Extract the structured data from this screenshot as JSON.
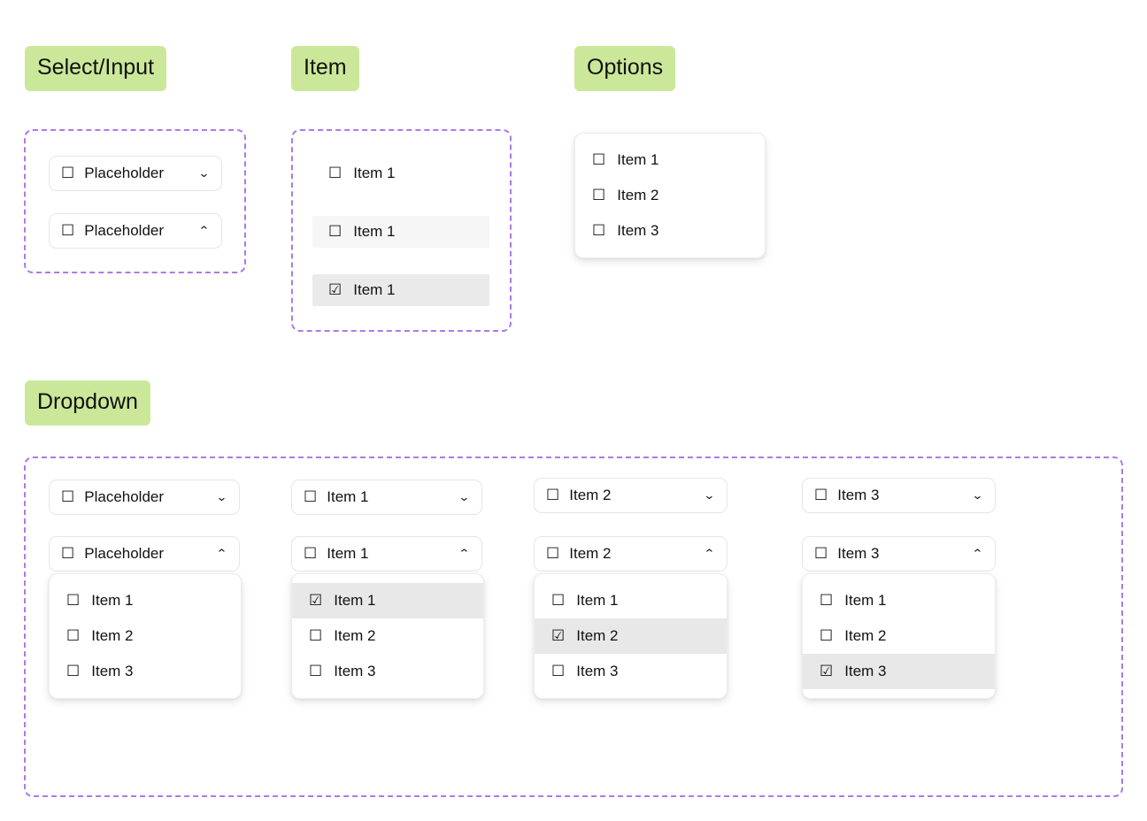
{
  "sections": {
    "select_input": {
      "label": "Select/Input"
    },
    "item": {
      "label": "Item"
    },
    "options": {
      "label": "Options"
    },
    "dropdown": {
      "label": "Dropdown"
    }
  },
  "glyphs": {
    "unchecked": "☐",
    "checked": "☑",
    "chevron_down": "⌄",
    "chevron_up": "⌃"
  },
  "colors": {
    "tag_green": "#cbe89a",
    "dashed_purple": "#ab7ae8",
    "control_border": "#e6e6e6",
    "row_hover": "#f6f6f6",
    "row_selected": "#e8e8e8",
    "text": "#111111"
  },
  "select_input_group": {
    "controls": [
      {
        "text": "Placeholder",
        "state": "closed",
        "checkbox": "unchecked"
      },
      {
        "text": "Placeholder",
        "state": "open",
        "checkbox": "unchecked"
      }
    ]
  },
  "item_group": {
    "rows": [
      {
        "text": "Item 1",
        "checkbox": "unchecked",
        "state": "default"
      },
      {
        "text": "Item 1",
        "checkbox": "unchecked",
        "state": "hover"
      },
      {
        "text": "Item 1",
        "checkbox": "checked",
        "state": "selected"
      }
    ]
  },
  "options_group": {
    "rows": [
      {
        "text": "Item 1",
        "checkbox": "unchecked",
        "state": "default"
      },
      {
        "text": "Item 2",
        "checkbox": "unchecked",
        "state": "default"
      },
      {
        "text": "Item 3",
        "checkbox": "unchecked",
        "state": "default"
      }
    ]
  },
  "dropdown_group": {
    "columns": [
      {
        "closed": {
          "text": "Placeholder",
          "checkbox": "unchecked"
        },
        "open": {
          "text": "Placeholder",
          "checkbox": "unchecked"
        },
        "options": [
          {
            "text": "Item 1",
            "checkbox": "unchecked",
            "state": "default"
          },
          {
            "text": "Item 2",
            "checkbox": "unchecked",
            "state": "default"
          },
          {
            "text": "Item 3",
            "checkbox": "unchecked",
            "state": "default"
          }
        ]
      },
      {
        "closed": {
          "text": "Item 1",
          "checkbox": "unchecked"
        },
        "open": {
          "text": "Item 1",
          "checkbox": "unchecked"
        },
        "options": [
          {
            "text": "Item 1",
            "checkbox": "checked",
            "state": "selected"
          },
          {
            "text": "Item 2",
            "checkbox": "unchecked",
            "state": "default"
          },
          {
            "text": "Item 3",
            "checkbox": "unchecked",
            "state": "default"
          }
        ]
      },
      {
        "closed": {
          "text": "Item 2",
          "checkbox": "unchecked"
        },
        "open": {
          "text": "Item 2",
          "checkbox": "unchecked"
        },
        "options": [
          {
            "text": "Item 1",
            "checkbox": "unchecked",
            "state": "default"
          },
          {
            "text": "Item 2",
            "checkbox": "checked",
            "state": "selected"
          },
          {
            "text": "Item 3",
            "checkbox": "unchecked",
            "state": "default"
          }
        ]
      },
      {
        "closed": {
          "text": "Item 3",
          "checkbox": "unchecked"
        },
        "open": {
          "text": "Item 3",
          "checkbox": "unchecked"
        },
        "options": [
          {
            "text": "Item 1",
            "checkbox": "unchecked",
            "state": "default"
          },
          {
            "text": "Item 2",
            "checkbox": "unchecked",
            "state": "default"
          },
          {
            "text": "Item 3",
            "checkbox": "checked",
            "state": "selected"
          }
        ]
      }
    ]
  }
}
